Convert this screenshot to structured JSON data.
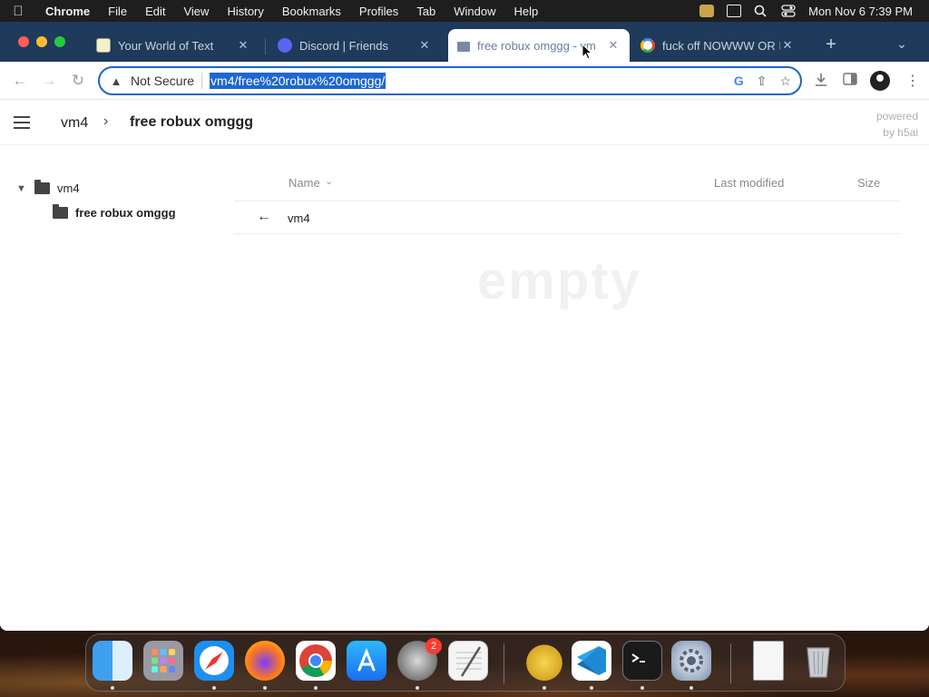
{
  "menubar": {
    "app_name": "Chrome",
    "items": [
      "File",
      "Edit",
      "View",
      "History",
      "Bookmarks",
      "Profiles",
      "Tab",
      "Window",
      "Help"
    ],
    "clock": "Mon Nov 6  7:39 PM"
  },
  "tabs": [
    {
      "title": "Your World of Text",
      "favicon": "yw-icon",
      "active": false
    },
    {
      "title": "Discord | Friends",
      "favicon": "discord-icon",
      "active": false
    },
    {
      "title": "free robux omggg - vm",
      "favicon": "folder-icon",
      "active": true
    },
    {
      "title": "fuck off NOWWW OR I",
      "favicon": "google-icon",
      "active": false
    }
  ],
  "omnibox": {
    "security_label": "Not Secure",
    "url": "vm4/free%20robux%20omggg/"
  },
  "page": {
    "breadcrumb_root": "vm4",
    "breadcrumb_current": "free robux omggg",
    "powered_line1": "powered",
    "powered_line2": "by h5ai",
    "tree": {
      "root": "vm4",
      "child": "free robux omggg"
    },
    "columns": {
      "name": "Name",
      "modified": "Last modified",
      "size": "Size"
    },
    "parent_link": "vm4",
    "empty_label": "empty"
  },
  "dock": {
    "apps": [
      "finder",
      "launchpad",
      "safari",
      "firefox",
      "chrome",
      "app-store",
      "system-preferences",
      "textedit",
      "cyberduck",
      "vscode",
      "terminal",
      "settings-utility",
      "preview",
      "trash"
    ],
    "system_preferences_badge": "2"
  },
  "colors": {
    "tabstrip": "#1f3a5a",
    "omnibox_border": "#1a66c9",
    "url_highlight": "#1f66d1"
  }
}
